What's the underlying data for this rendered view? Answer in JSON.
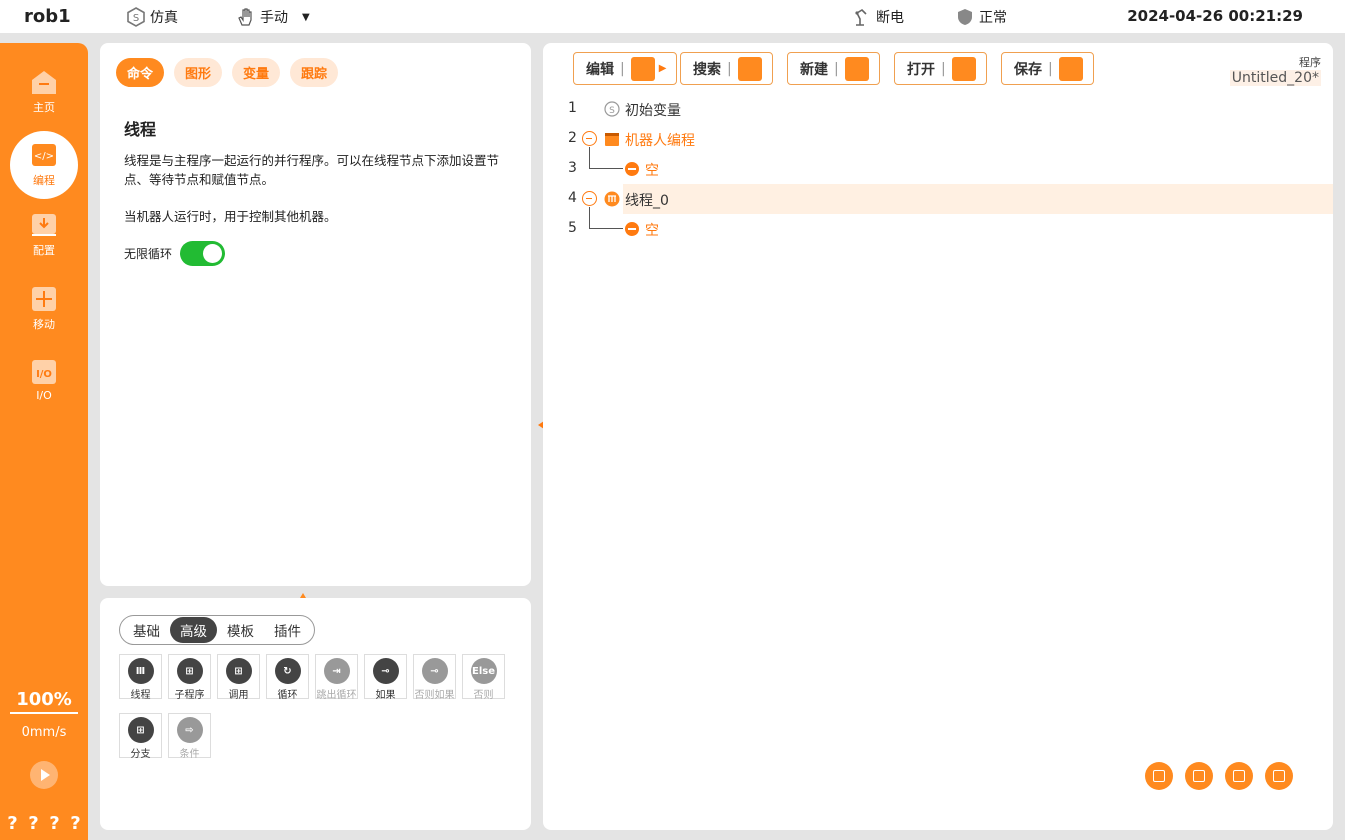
{
  "topbar": {
    "robot": "rob1",
    "sim_label": "仿真",
    "mode_label": "手动",
    "power_label": "断电",
    "status_label": "正常",
    "datetime": "2024-04-26 00:21:29"
  },
  "nav": {
    "items": [
      {
        "label": "主页",
        "icon": "home-icon"
      },
      {
        "label": "编程",
        "icon": "code-icon"
      },
      {
        "label": "配置",
        "icon": "config-icon"
      },
      {
        "label": "移动",
        "icon": "move-icon"
      },
      {
        "label": "I/O",
        "icon": "io-icon"
      }
    ],
    "speed_percent": "100%",
    "speed_value": "0mm/s",
    "help": [
      "?",
      "?",
      "?",
      "?"
    ]
  },
  "command_panel": {
    "tabs": [
      "命令",
      "图形",
      "变量",
      "跟踪"
    ],
    "title": "线程",
    "description": "线程是与主程序一起运行的并行程序。可以在线程节点下添加设置节点、等待节点和赋值节点。",
    "description2": "当机器人运行时，用于控制其他机器。",
    "loop_label": "无限循环",
    "loop_on": true
  },
  "node_panel": {
    "segments": [
      "基础",
      "高级",
      "模板",
      "插件"
    ],
    "nodes": [
      {
        "label": "线程",
        "glyph": "Ⅲ"
      },
      {
        "label": "子程序",
        "glyph": "⊞"
      },
      {
        "label": "调用",
        "glyph": "⊞"
      },
      {
        "label": "循环",
        "glyph": "↻"
      },
      {
        "label": "跳出循环",
        "glyph": "⇥"
      },
      {
        "label": "如果",
        "glyph": "⊸"
      },
      {
        "label": "否则如果",
        "glyph": "⊸"
      },
      {
        "label": "否则",
        "glyph": "Else"
      },
      {
        "label": "分支",
        "glyph": "⊞"
      },
      {
        "label": "条件",
        "glyph": "⇨"
      }
    ]
  },
  "program": {
    "buttons": [
      "编辑",
      "搜索",
      "新建",
      "打开",
      "保存"
    ],
    "label": "程序",
    "name": "Untitled_20*",
    "lines": [
      {
        "no": "1",
        "text": "初始变量"
      },
      {
        "no": "2",
        "text": "机器人编程"
      },
      {
        "no": "3",
        "text": "空"
      },
      {
        "no": "4",
        "text": "线程_0"
      },
      {
        "no": "5",
        "text": "空"
      }
    ]
  },
  "colors": {
    "accent": "#ff8a1f",
    "active_toggle": "#22bb33"
  }
}
